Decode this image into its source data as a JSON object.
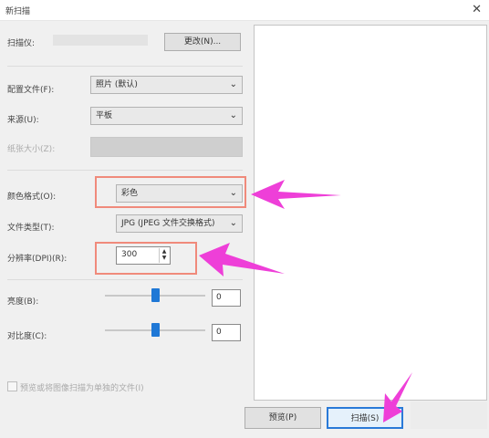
{
  "window": {
    "title": "新扫描",
    "close_glyph": "✕"
  },
  "scanner": {
    "label": "扫描仪:",
    "value_blurred": "",
    "change_button": "更改(N)..."
  },
  "profile": {
    "label": "配置文件(F):",
    "value": "照片 (默认)"
  },
  "source": {
    "label": "来源(U):",
    "value": "平板"
  },
  "paper_size": {
    "label": "纸张大小(Z):",
    "value": ""
  },
  "color_format": {
    "label": "颜色格式(O):",
    "value": "彩色"
  },
  "file_type": {
    "label": "文件类型(T):",
    "value": "JPG (JPEG 文件交换格式)"
  },
  "resolution": {
    "label": "分辨率(DPI)(R):",
    "value": "300",
    "up": "▲",
    "down": "▼"
  },
  "brightness": {
    "label": "亮度(B):",
    "value": "0",
    "level": 0.5
  },
  "contrast": {
    "label": "对比度(C):",
    "value": "0",
    "level": 0.5
  },
  "separate_files": {
    "label": "预览或将图像扫描为单独的文件(I)",
    "checked": false
  },
  "buttons": {
    "preview": "预览(P)",
    "scan": "扫描(S)",
    "cancel": ""
  },
  "chevron": "⌄",
  "colors": {
    "highlight_box": "#f08a7b",
    "arrow": "#ee3fd8",
    "slider": "#1f78d6"
  }
}
